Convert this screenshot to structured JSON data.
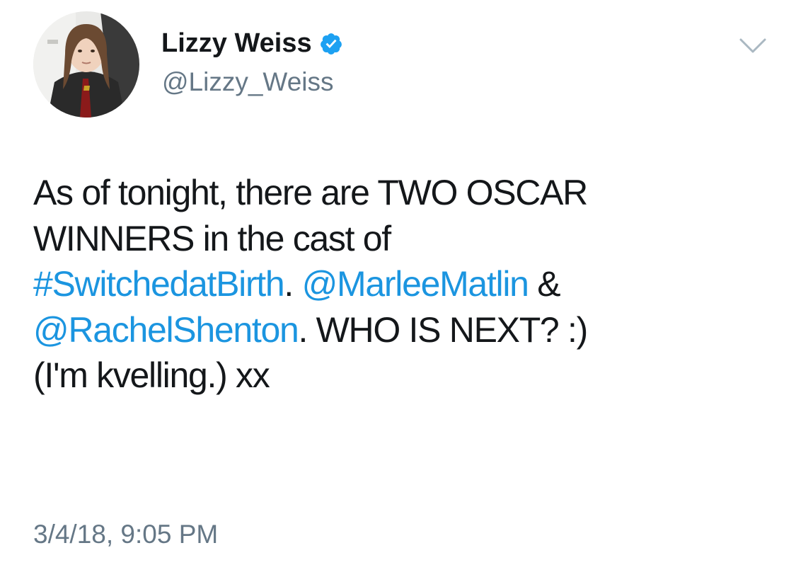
{
  "colors": {
    "text": "#14171a",
    "secondary": "#657786",
    "link": "#1b95e0",
    "verified": "#1da1f2",
    "background": "#ffffff"
  },
  "author": {
    "display_name": "Lizzy Weiss",
    "handle": "@Lizzy_Weiss",
    "verified": true,
    "avatar": "profile-photo"
  },
  "icons": {
    "verified": "verified-badge-icon",
    "more": "chevron-down-icon"
  },
  "tweet": {
    "line1": "As of tonight, there are TWO OSCAR",
    "line2": "WINNERS in the cast of",
    "hashtag": "#SwitchedatBirth",
    "after_hashtag": ". ",
    "mention1": "@MarleeMatlin",
    "after_mention1": " &",
    "mention2": "@RachelShenton",
    "after_mention2": ". WHO IS NEXT? :)",
    "line5": "(I'm kvelling.) xx"
  },
  "timestamp": "3/4/18, 9:05 PM"
}
